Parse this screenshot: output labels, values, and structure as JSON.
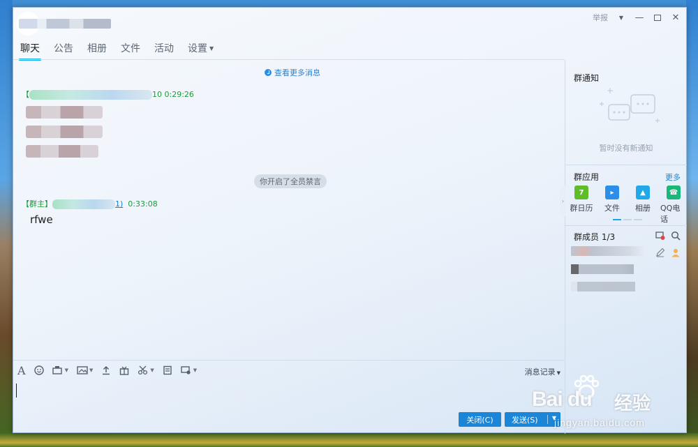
{
  "window": {
    "report_label": "举报",
    "controls": [
      "dropdown",
      "minimize",
      "maximize",
      "close"
    ]
  },
  "tabs": [
    {
      "label": "聊天",
      "active": true
    },
    {
      "label": "公告"
    },
    {
      "label": "相册"
    },
    {
      "label": "文件"
    },
    {
      "label": "活动"
    },
    {
      "label": "设置"
    }
  ],
  "chat": {
    "more_messages": "查看更多消息",
    "messages": [
      {
        "header_suffix": "10 0:29:26"
      },
      {
        "role": "【群主】",
        "header_suffix": "1)",
        "time": "0:33:08",
        "text": "rfwe"
      }
    ],
    "system_notice": "你开启了全员禁言"
  },
  "toolbar": {
    "icons": [
      "font-icon",
      "emoji-icon",
      "screenshot-icon",
      "image-icon",
      "upload-icon",
      "gift-icon",
      "scissors-icon",
      "archive-icon",
      "more-icon"
    ],
    "history_label": "消息记录"
  },
  "buttons": {
    "close_label": "关闭(C)",
    "send_label": "发送(S)"
  },
  "sidebar": {
    "notice_title": "群通知",
    "notice_empty": "暂时没有新通知",
    "apps_title": "群应用",
    "apps_more": "更多",
    "apps": [
      {
        "label": "群日历",
        "color": "#5fbd2a",
        "glyph": "7"
      },
      {
        "label": "文件",
        "color": "#2b8ee8",
        "glyph": "▸"
      },
      {
        "label": "相册",
        "color": "#22a8e8",
        "glyph": "▲"
      },
      {
        "label": "QQ电话",
        "color": "#18b87a",
        "glyph": "☎"
      }
    ],
    "members_title": "群成员 1/3"
  },
  "watermark": {
    "brand": "Bai du",
    "brand_cn": "经验",
    "url": "jingyan.baidu.com"
  }
}
